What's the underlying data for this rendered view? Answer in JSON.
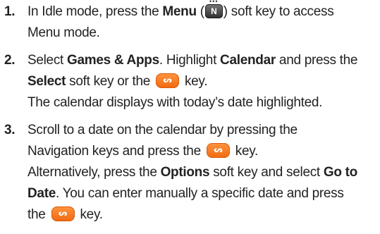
{
  "steps": [
    {
      "number": "1.",
      "lines": [
        {
          "pre": "In Idle mode, press the ",
          "bold": "Menu",
          "mid": " (",
          "post": ") soft key to access"
        },
        {
          "text": "Menu mode."
        }
      ]
    },
    {
      "number": "2.",
      "lines": [
        {
          "pre": "Select ",
          "bold1": "Games & Apps",
          "mid": ". Highlight ",
          "bold2": "Calendar",
          "post": " and press the"
        },
        {
          "bold": "Select",
          "mid": " soft key or the ",
          "post": " key."
        },
        {
          "text": "The calendar displays with today’s date highlighted."
        }
      ]
    },
    {
      "number": "3.",
      "lines": [
        {
          "text": "Scroll to a date on the calendar by pressing the"
        },
        {
          "pre": "Navigation keys and press the ",
          "post": " key."
        },
        {
          "pre": "Alternatively, press the ",
          "bold1": "Options",
          "mid": " soft key and select ",
          "bold2": "Go to"
        },
        {
          "bold": "Date",
          "post": ". You can enter manually a specific date and press"
        },
        {
          "pre": "the ",
          "post": " key."
        }
      ]
    }
  ],
  "icons": {
    "menu_key": {
      "name": "menu-key-icon",
      "glyph": "N",
      "dots": "•••",
      "color": "#2c2c2c"
    },
    "ok_key": {
      "name": "ok-key-icon",
      "glyph": "ᔕ",
      "color": "#f06a10"
    }
  }
}
